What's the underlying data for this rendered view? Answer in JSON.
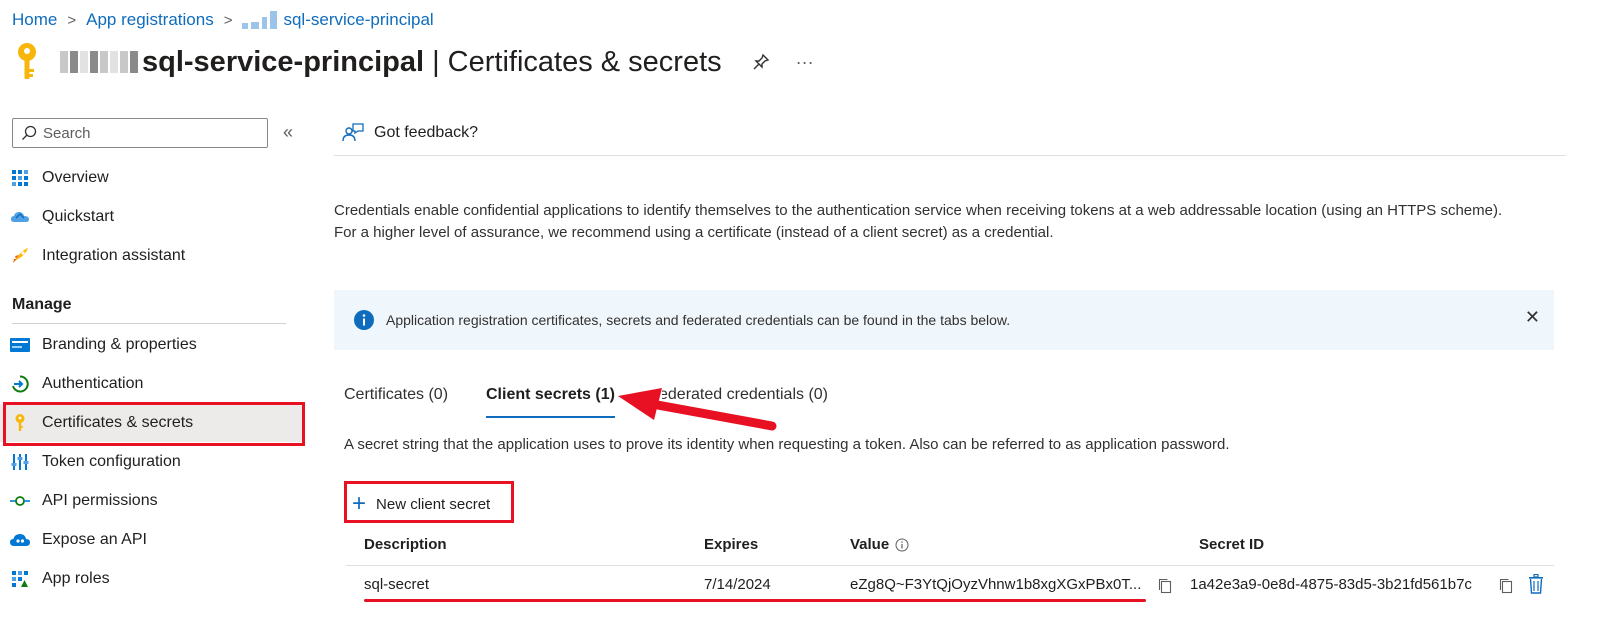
{
  "breadcrumb": {
    "home": "Home",
    "app_registrations": "App registrations",
    "current": "sql-service-principal"
  },
  "header": {
    "title": "sql-service-principal",
    "subtitle": "| Certificates & secrets",
    "pin_icon": "pin-icon",
    "more": "···"
  },
  "sidebar": {
    "search_placeholder": "Search",
    "collapse": "«",
    "items_top": [
      {
        "label": "Overview",
        "icon": "overview-icon"
      },
      {
        "label": "Quickstart",
        "icon": "quickstart-icon"
      },
      {
        "label": "Integration assistant",
        "icon": "rocket-icon"
      }
    ],
    "section_manage": "Manage",
    "items_manage": [
      {
        "label": "Branding & properties",
        "icon": "branding-icon"
      },
      {
        "label": "Authentication",
        "icon": "authentication-icon"
      },
      {
        "label": "Certificates & secrets",
        "icon": "key-icon"
      },
      {
        "label": "Token configuration",
        "icon": "token-icon"
      },
      {
        "label": "API permissions",
        "icon": "api-permissions-icon"
      },
      {
        "label": "Expose an API",
        "icon": "cloud-icon"
      },
      {
        "label": "App roles",
        "icon": "app-roles-icon"
      }
    ]
  },
  "main": {
    "feedback": "Got feedback?",
    "description": "Credentials enable confidential applications to identify themselves to the authentication service when receiving tokens at a web addressable location (using an HTTPS scheme). For a higher level of assurance, we recommend using a certificate (instead of a client secret) as a credential.",
    "info_message": "Application registration certificates, secrets and federated credentials can be found in the tabs below.",
    "info_close": "✕",
    "tabs": [
      {
        "label": "Certificates (0)"
      },
      {
        "label": "Client secrets (1)"
      },
      {
        "label": "Federated credentials (0)"
      }
    ],
    "tab_description": "A secret string that the application uses to prove its identity when requesting a token. Also can be referred to as application password.",
    "new_secret_button": "New client secret",
    "table": {
      "headers": [
        "Description",
        "Expires",
        "Value",
        "Secret ID"
      ],
      "row": {
        "description": "sql-secret",
        "expires": "7/14/2024",
        "value": "eZg8Q~F3YtQjOyzVhnw1b8xgXGxPBx0T...",
        "secret_id": "1a42e3a9-0e8d-4875-83d5-3b21fd561b7c"
      }
    }
  },
  "colors": {
    "accent": "#0f6cbd",
    "highlight_red": "#e81123",
    "info_bg": "#eff6fc"
  }
}
